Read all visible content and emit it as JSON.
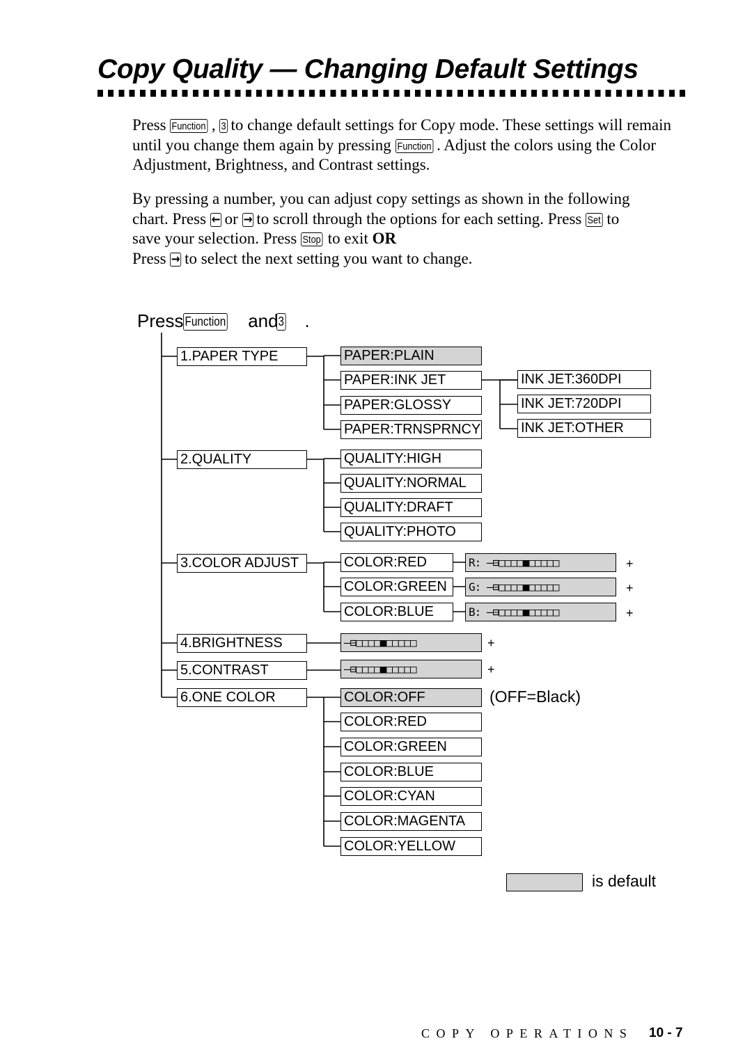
{
  "title": "Copy Quality — Changing Default Settings",
  "paragraph1": {
    "t1": "Press ",
    "k1": "Function",
    "t2": ", ",
    "k2": "3",
    "t3": " to change default settings for Copy mode. These settings will remain until you change them again by pressing ",
    "k3": "Function",
    "t4": ". Adjust the colors using the Color Adjustment, Brightness, and Contrast settings."
  },
  "paragraph2": {
    "t1": "By  pressing a number, you can adjust copy settings as shown in the following chart. Press ",
    "k_left": "←",
    "t2": " or ",
    "k_right": "→",
    "t3": " to scroll through the options for each setting. Press ",
    "k_set": "Set",
    "t4": " to save your selection. Press ",
    "k_stop": "Stop",
    "t5": " to exit ",
    "or": "OR",
    "t6": "Press ",
    "k_right2": "→",
    "t7": " to select the next setting you want to change."
  },
  "chart": {
    "press": "Press",
    "key_function": "Function",
    "and": "and",
    "key_3": "3",
    "period": ".",
    "categories": [
      {
        "label": "1.PAPER TYPE",
        "options": [
          "PAPER:PLAIN",
          "PAPER:INK JET",
          "PAPER:GLOSSY",
          "PAPER:TRNSPRNCY"
        ],
        "default": 0
      },
      {
        "label": "2.QUALITY",
        "options": [
          "QUALITY:HIGH",
          "QUALITY:NORMAL",
          "QUALITY:DRAFT",
          "QUALITY:PHOTO"
        ]
      },
      {
        "label": "3.COLOR ADJUST",
        "options": [
          "COLOR:RED",
          "COLOR:GREEN",
          "COLOR:BLUE"
        ]
      },
      {
        "label": "4.BRIGHTNESS"
      },
      {
        "label": "5.CONTRAST"
      },
      {
        "label": "6.ONE COLOR",
        "options": [
          "COLOR:OFF",
          "COLOR:RED",
          "COLOR:GREEN",
          "COLOR:BLUE",
          "COLOR:CYAN",
          "COLOR:MAGENTA",
          "COLOR:YELLOW"
        ],
        "default": 0
      }
    ],
    "ink_jet_options": [
      "INK JET:360DPI",
      "INK JET:720DPI",
      "INK JET:OTHER"
    ],
    "color_sliders": [
      "R:",
      "G:",
      "B:"
    ],
    "slider_steps": 11,
    "slider_value": 6,
    "slider_minus": "–",
    "slider_plus": "+",
    "off_note": "(OFF=Black)",
    "legend": "is default",
    "default_color": "#d4d4d4"
  },
  "footer": {
    "section": "COPY OPERATIONS",
    "page": "10 - 7"
  }
}
